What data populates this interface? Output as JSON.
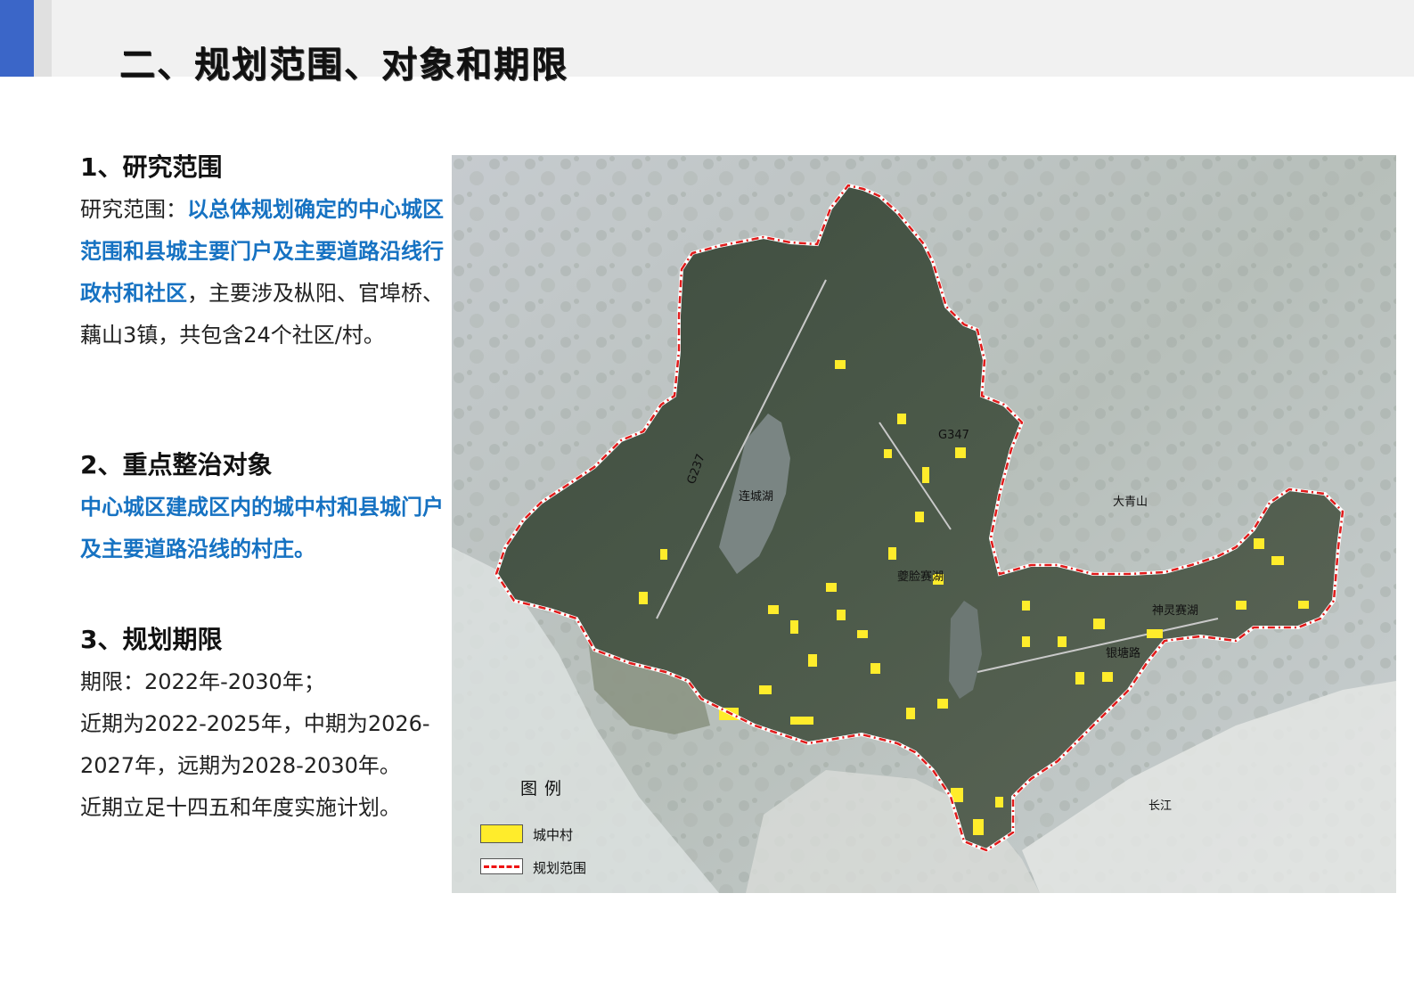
{
  "header": {
    "title": "二、规划范围、对象和期限",
    "accent_color": "#3b66c8"
  },
  "section1": {
    "heading": "1、研究范围",
    "prefix": "研究范围：",
    "highlight": "以总体规划确定的中心城区范围和县城主要门户及主要道路沿线行政村和社区",
    "rest": "，主要涉及枞阳、官埠桥、藕山3镇，共包含24个社区/村。"
  },
  "section2": {
    "heading": "2、重点整治对象",
    "highlight": "中心城区建成区内的城中村和县城门户及主要道路沿线的村庄。"
  },
  "section3": {
    "heading": "3、规划期限",
    "line1": "期限：2022年-2030年；",
    "line2": "近期为2022-2025年，中期为2026-2027年，远期为2028-2030年。",
    "line3": "近期立足十四五和年度实施计划。"
  },
  "map": {
    "labels": {
      "g237": "G237",
      "g347": "G347",
      "lianchenghu": "连城湖",
      "kuilian": "夔脸赛湖",
      "daqingshan": "大青山",
      "shenling": "神灵赛湖",
      "yintang": "银塘路",
      "changjiang": "长江"
    },
    "boundary_color": "#e11b1b",
    "village_color": "#ffec2b"
  },
  "legend": {
    "title": "图例",
    "items": [
      {
        "label": "城中村",
        "color": "#ffec2b"
      },
      {
        "label": "规划范围",
        "color": "#e11b1b"
      }
    ]
  }
}
